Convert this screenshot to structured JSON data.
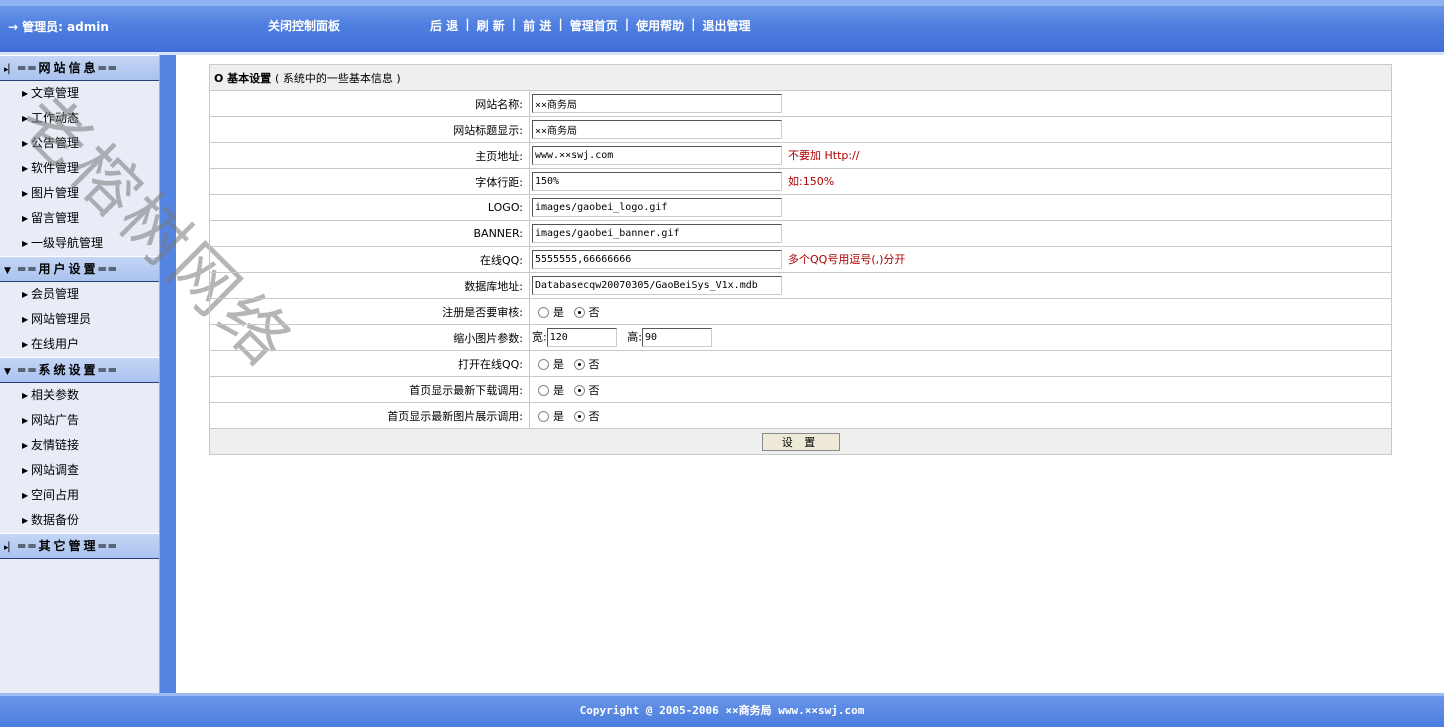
{
  "header": {
    "admin_arrow": "→",
    "admin_label": "管理员: admin",
    "close_panel": "关闭控制面板",
    "nav": [
      "后 退",
      "刷 新",
      "前 进",
      "管理首页",
      "使用帮助",
      "退出管理"
    ],
    "nav_sep": "|"
  },
  "sidebar": {
    "sections": [
      {
        "title": "══网站信息══",
        "expanded": true,
        "items": [
          "文章管理",
          "工作动态",
          "公告管理",
          "软件管理",
          "图片管理",
          "留言管理",
          "一级导航管理"
        ]
      },
      {
        "title": "══用户设置══",
        "expanded": true,
        "items": [
          "会员管理",
          "网站管理员",
          "在线用户"
        ]
      },
      {
        "title": "══系统设置══",
        "expanded": true,
        "items": [
          "相关参数",
          "网站广告",
          "友情链接",
          "网站调查",
          "空间占用",
          "数据备份"
        ]
      },
      {
        "title": "══其它管理══",
        "expanded": false,
        "items": []
      }
    ]
  },
  "watermark": "老榕树网络",
  "form": {
    "title": "O 基本设置",
    "subtitle": "( 系统中的一些基本信息 )",
    "site_name": {
      "label": "网站名称:",
      "value": "××商务局"
    },
    "site_title": {
      "label": "网站标题显示:",
      "value": "××商务局"
    },
    "home_url": {
      "label": "主页地址:",
      "value": "www.××swj.com",
      "hint": "不要加 Http://"
    },
    "line_height": {
      "label": "字体行距:",
      "value": "150%",
      "hint": "如:150%"
    },
    "logo": {
      "label": "LOGO:",
      "value": "images/gaobei_logo.gif"
    },
    "banner": {
      "label": "BANNER:",
      "value": "images/gaobei_banner.gif"
    },
    "qq": {
      "label": "在线QQ:",
      "value": "5555555,66666666",
      "hint": "多个QQ号用逗号(,)分开"
    },
    "db": {
      "label": "数据库地址:",
      "value": "Databasecqw20070305/GaoBeiSys_V1x.mdb"
    },
    "reg_audit": {
      "label": "注册是否要审核:",
      "selected": "no"
    },
    "thumb": {
      "label": "缩小图片参数:",
      "width_label": "宽:",
      "width": "120",
      "height_label": "高:",
      "height": "90"
    },
    "open_qq": {
      "label": "打开在线QQ:",
      "selected": "no"
    },
    "latest_dl": {
      "label": "首页显示最新下载调用:",
      "selected": "no"
    },
    "latest_img": {
      "label": "首页显示最新图片展示调用:",
      "selected": "no"
    },
    "yes": "是",
    "no": "否",
    "submit": "设 置"
  },
  "footer": "Copyright @ 2005-2006 ××商务局  www.××swj.com"
}
